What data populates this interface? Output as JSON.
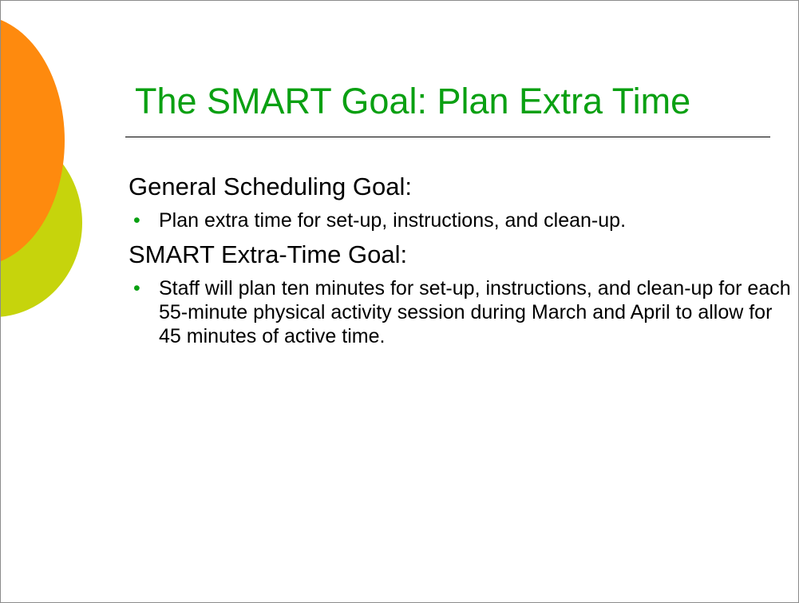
{
  "slide": {
    "title": "The SMART Goal: Plan Extra Time",
    "sections": [
      {
        "heading": "General Scheduling Goal:",
        "bullet": "Plan extra time for set-up, instructions, and clean-up."
      },
      {
        "heading": "SMART Extra-Time Goal:",
        "bullet": "Staff will plan ten minutes for set-up, instructions, and clean-up for each 55-minute physical activity session during March and April to allow for 45 minutes of active time."
      }
    ],
    "bullet_glyph": "•"
  },
  "colors": {
    "title": "#0aa012",
    "bullet": "#0aa012",
    "deco_orange": "#fe8a0e",
    "deco_green": "#c6d40c"
  }
}
